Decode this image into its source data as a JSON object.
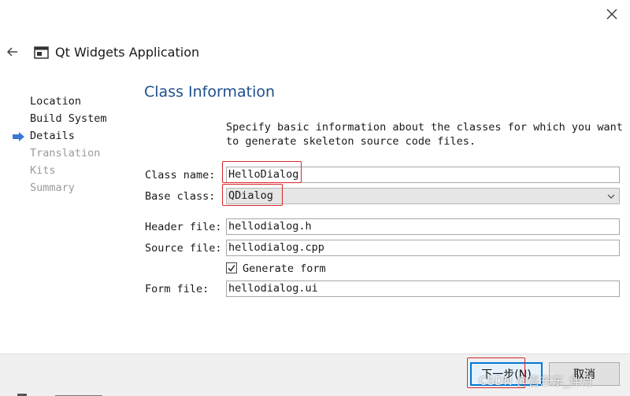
{
  "wizard": {
    "title": "Qt Widgets Application"
  },
  "steps": [
    {
      "label": "Location",
      "state": "done"
    },
    {
      "label": "Build System",
      "state": "done"
    },
    {
      "label": "Details",
      "state": "current"
    },
    {
      "label": "Translation",
      "state": "todo"
    },
    {
      "label": "Kits",
      "state": "todo"
    },
    {
      "label": "Summary",
      "state": "todo"
    }
  ],
  "page": {
    "heading": "Class Information",
    "description": "Specify basic information about the classes for which you want to generate skeleton source code files."
  },
  "form": {
    "class_name_label": "Class name:",
    "class_name_value": "HelloDialog",
    "base_class_label": "Base class:",
    "base_class_value": "QDialog",
    "header_file_label": "Header file:",
    "header_file_value": "hellodialog.h",
    "source_file_label": "Source file:",
    "source_file_value": "hellodialog.cpp",
    "generate_form_label": "Generate form",
    "generate_form_checked": true,
    "form_file_label": "Form file:",
    "form_file_value": "hellodialog.ui"
  },
  "buttons": {
    "next": "下一步(N)",
    "cancel": "取消"
  },
  "watermark": "CSDN @喜东东_伴月",
  "colors": {
    "heading": "#1f4e8c",
    "highlight": "#d9262c",
    "focus": "#0078d7",
    "current_arrow": "#3a78d4"
  },
  "icons": [
    "close-icon",
    "back-arrow-icon",
    "application-window-icon",
    "current-step-arrow-icon",
    "chevron-down-icon",
    "checkmark-icon"
  ]
}
